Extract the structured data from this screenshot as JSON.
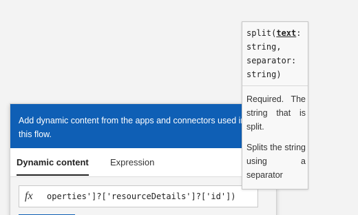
{
  "panel": {
    "header_text": "Add dynamic content from the apps and connectors used in this flow.",
    "tabs": [
      {
        "label": "Dynamic content",
        "active": true
      },
      {
        "label": "Expression",
        "active": false
      }
    ],
    "formula": {
      "fx_label": "fx",
      "expression": "operties']?['resourceDetails']?['id'])"
    }
  },
  "tooltip": {
    "signature": {
      "fn": "split(",
      "param1": "text",
      "rest": ": string, separator: string)"
    },
    "param_description": "Required. The string that is split.",
    "function_description": "Splits the string using a separator"
  },
  "colors": {
    "accent": "#0f5fb5"
  }
}
